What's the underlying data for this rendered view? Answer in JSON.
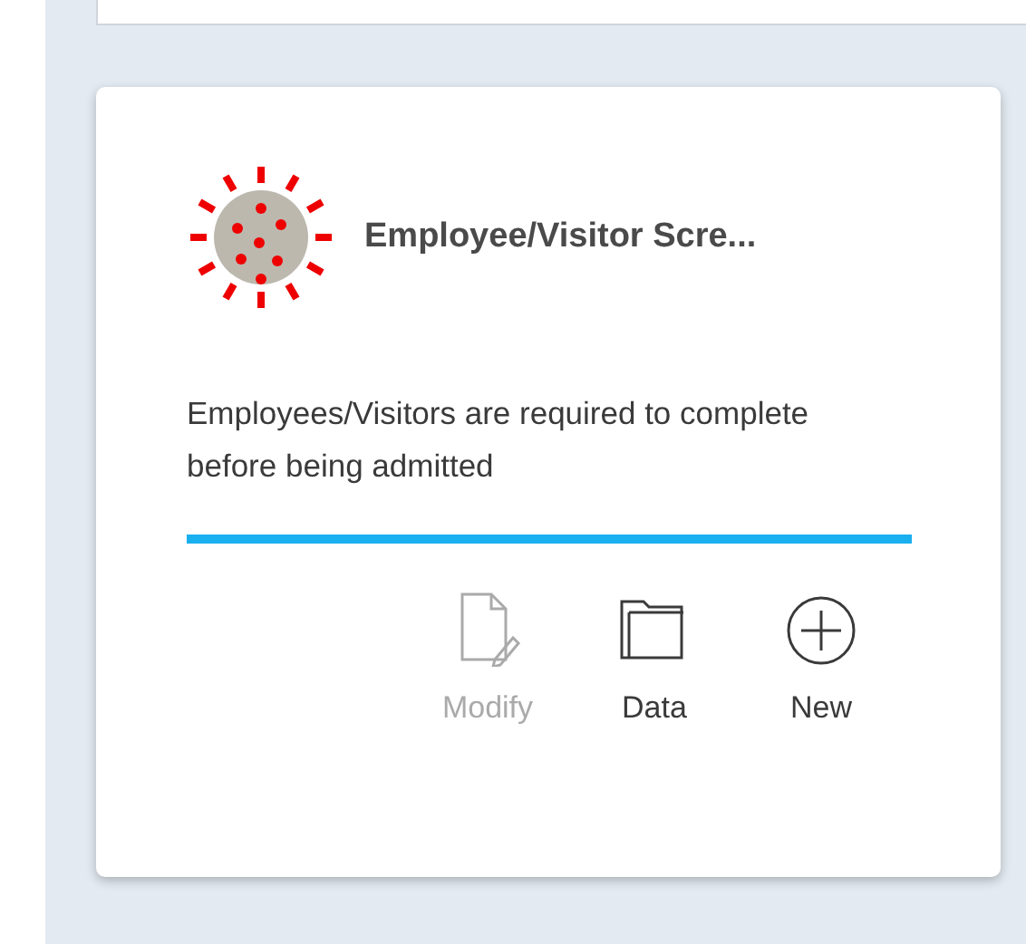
{
  "card": {
    "title": "Employee/Visitor Scre...",
    "description": "Employees/Visitors are required to complete before being admitted",
    "progress": {
      "level": 1
    },
    "actions": [
      {
        "kind": "modify",
        "label": "Modify",
        "disabled": true
      },
      {
        "kind": "data",
        "label": "Data",
        "disabled": false
      },
      {
        "kind": "new",
        "label": "New",
        "disabled": false
      }
    ]
  }
}
